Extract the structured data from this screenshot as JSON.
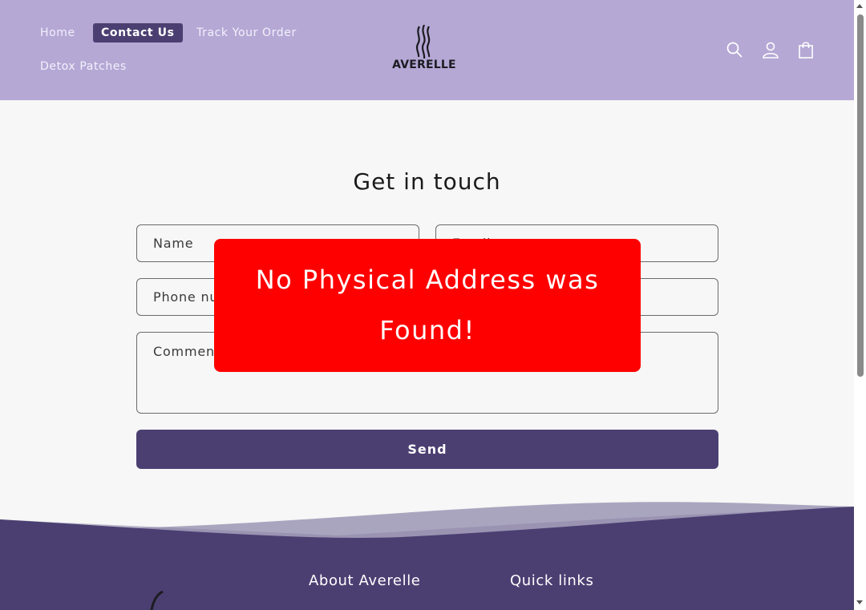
{
  "nav": {
    "items": [
      {
        "label": "Home"
      },
      {
        "label": "Contact Us"
      },
      {
        "label": "Track Your Order"
      },
      {
        "label": "Detox Patches"
      }
    ]
  },
  "brand": {
    "name": "AVERELLE"
  },
  "header_icons": [
    "search-icon",
    "account-icon",
    "cart-icon"
  ],
  "contact": {
    "title": "Get in touch",
    "name_placeholder": "Name",
    "email_placeholder": "Email",
    "phone_placeholder": "Phone number",
    "comment_placeholder": "Comment",
    "send_label": "Send"
  },
  "alert": {
    "line1": "No Physical Address was",
    "line2": "Found!"
  },
  "footer": {
    "about_heading": "About Averelle",
    "links_heading": "Quick links"
  },
  "colors": {
    "header_bg": "#b5a8d5",
    "accent": "#4b3f72",
    "alert_bg": "#ff0000",
    "page_bg": "#f6f7f6"
  }
}
